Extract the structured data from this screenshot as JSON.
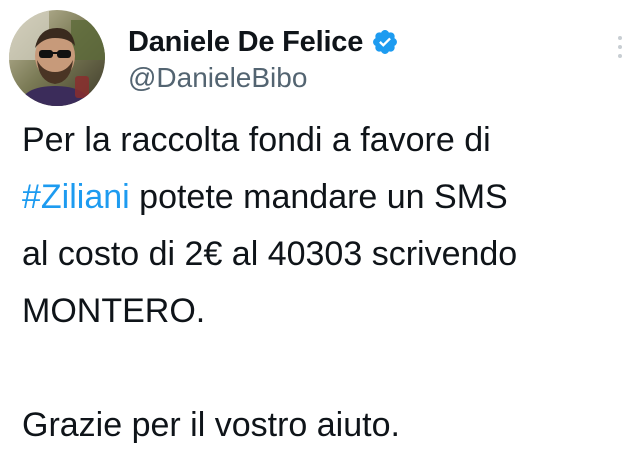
{
  "author": {
    "display_name": "Daniele De Felice",
    "handle": "@DanieleBibo",
    "verified": true,
    "avatar_icon": "profile-photo"
  },
  "tweet": {
    "line1": "Per la raccolta fondi a favore di",
    "hashtag": "#Ziliani",
    "line2_rest": " potete mandare un SMS",
    "line3": "al costo di 2€ al 40303 scrivendo",
    "line4": "MONTERO.",
    "line5": "Grazie per il vostro aiuto."
  },
  "colors": {
    "hashtag": "#1d9bf0",
    "verified_badge": "#1d9bf0",
    "handle": "#536471",
    "text": "#0f1419"
  },
  "icons": {
    "verified": "verified-badge-icon",
    "more": "more-options-icon"
  }
}
